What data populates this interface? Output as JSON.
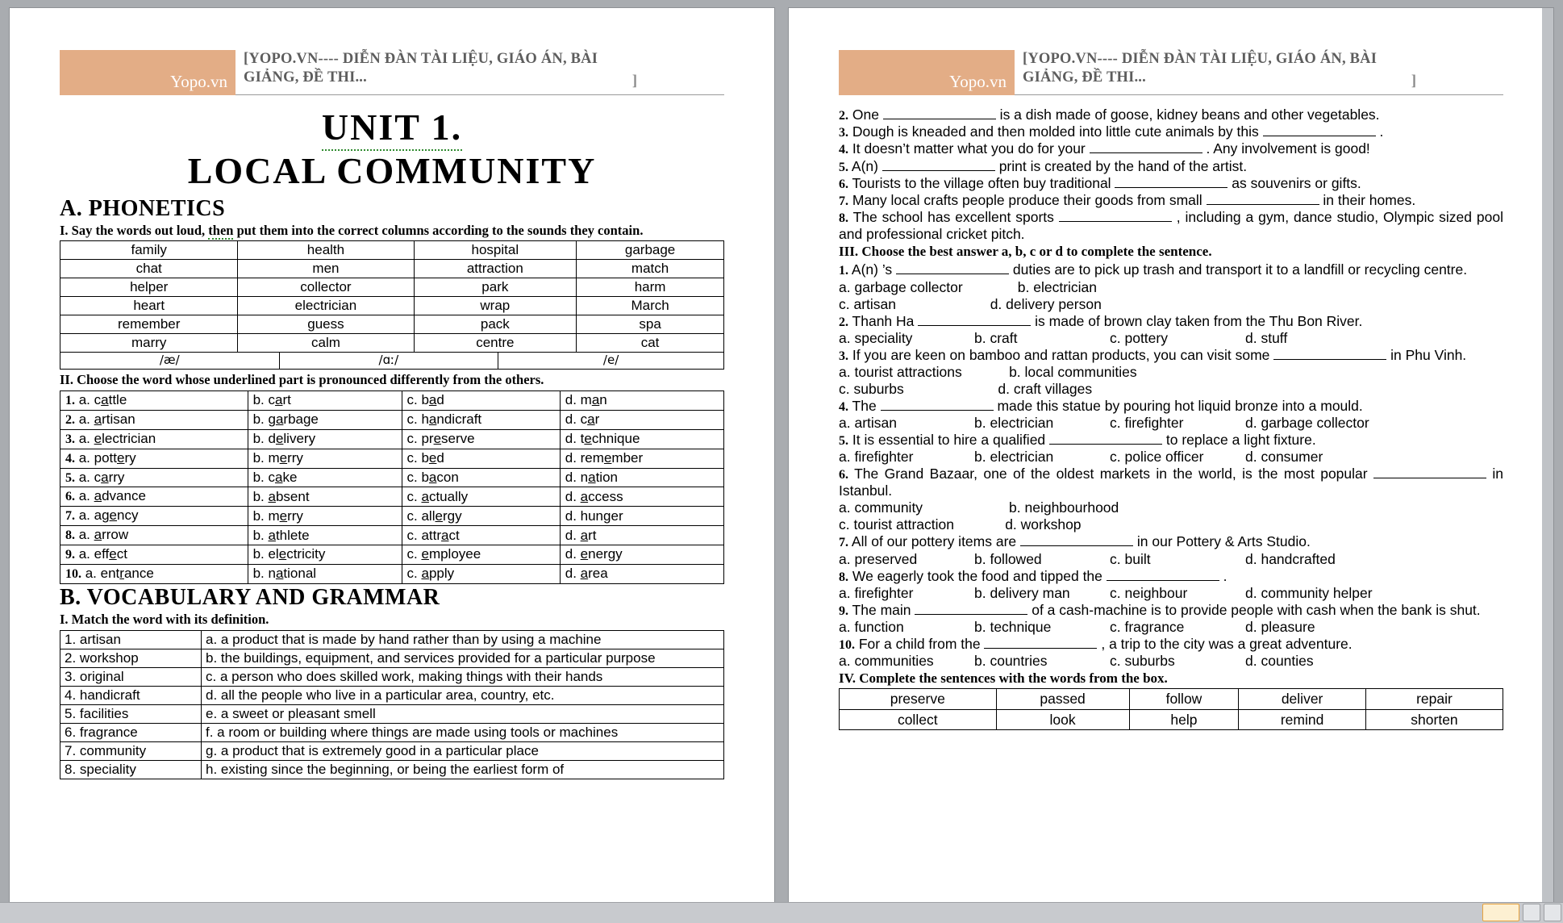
{
  "header": {
    "brand": "Yopo.vn",
    "line1": "[YOPO.VN---- DIỄN ĐÀN TÀI LIỆU, GIÁO ÁN, BÀI",
    "line2": "GIẢNG, ĐỀ THI...",
    "bracket_end": "]",
    "brand_color": "#e3ad86"
  },
  "page1": {
    "unit_title": "UNIT 1.",
    "unit_subtitle": "LOCAL COMMUNITY",
    "section_a": "A. PHONETICS",
    "exercise_i": "I. Say the words out loud, then put them into the correct columns according to the sounds they contain.",
    "exercise_i_squiggle_word": "then",
    "word_table": [
      [
        "family",
        "health",
        "hospital",
        "garbage"
      ],
      [
        "chat",
        "men",
        "attraction",
        "match"
      ],
      [
        "helper",
        "collector",
        "park",
        "harm"
      ],
      [
        "heart",
        "electrician",
        "wrap",
        "March"
      ],
      [
        "remember",
        "guess",
        "pack",
        "spa"
      ],
      [
        "marry",
        "calm",
        "centre",
        "cat"
      ]
    ],
    "phonetic_row": [
      "/æ/",
      "/ɑː/",
      "/e/"
    ],
    "exercise_ii": "II. Choose the word whose underlined part is pronounced differently from the others.",
    "choices": [
      {
        "n": "1.",
        "a": [
          "c",
          "a",
          "ttle"
        ],
        "b": [
          "c",
          "a",
          "rt"
        ],
        "c": [
          "b",
          "a",
          "d"
        ],
        "d": [
          "m",
          "a",
          "n"
        ]
      },
      {
        "n": "2.",
        "a": [
          "",
          "a",
          "rtisan"
        ],
        "b": [
          "g",
          "a",
          "rbage"
        ],
        "c": [
          "h",
          "a",
          "ndicraft"
        ],
        "d": [
          "c",
          "a",
          "r"
        ]
      },
      {
        "n": "3.",
        "a": [
          "",
          "e",
          "lectrician"
        ],
        "b": [
          "d",
          "e",
          "livery"
        ],
        "c": [
          "pr",
          "e",
          "serve"
        ],
        "d": [
          "t",
          "e",
          "chnique"
        ]
      },
      {
        "n": "4.",
        "a": [
          "pott",
          "e",
          "ry"
        ],
        "b": [
          "m",
          "e",
          "rry"
        ],
        "c": [
          "b",
          "e",
          "d"
        ],
        "d": [
          "rem",
          "e",
          "mber"
        ]
      },
      {
        "n": "5.",
        "a": [
          "c",
          "a",
          "rry"
        ],
        "b": [
          "c",
          "a",
          "ke"
        ],
        "c": [
          "b",
          "a",
          "con"
        ],
        "d": [
          "n",
          "a",
          "tion"
        ]
      },
      {
        "n": "6.",
        "a": [
          "",
          "a",
          "dvance"
        ],
        "b": [
          "",
          "a",
          "bsent"
        ],
        "c": [
          "",
          "a",
          "ctually"
        ],
        "d": [
          "",
          "a",
          "ccess"
        ]
      },
      {
        "n": "7.",
        "a": [
          "ag",
          "e",
          "ncy"
        ],
        "b": [
          "m",
          "e",
          "rry"
        ],
        "c": [
          "all",
          "e",
          "rgy"
        ],
        "d": [
          "hun",
          "g",
          "er"
        ]
      },
      {
        "n": "8.",
        "a": [
          "",
          "a",
          "rrow"
        ],
        "b": [
          "",
          "a",
          "thlete"
        ],
        "c": [
          "attr",
          "a",
          "ct"
        ],
        "d": [
          "",
          "a",
          "rt"
        ]
      },
      {
        "n": "9.",
        "a": [
          "eff",
          "e",
          "ct"
        ],
        "b": [
          "el",
          "e",
          "ctricity"
        ],
        "c": [
          "",
          "e",
          "mployee"
        ],
        "d": [
          "",
          "e",
          "nergy"
        ]
      },
      {
        "n": "10.",
        "a": [
          "ent",
          "r",
          "ance"
        ],
        "b": [
          "n",
          "a",
          "tional"
        ],
        "c": [
          "",
          "a",
          "pply"
        ],
        "d": [
          "",
          "a",
          "rea"
        ]
      }
    ],
    "section_b": "B. VOCABULARY AND GRAMMAR",
    "match_instruction": "I. Match the word with its definition.",
    "match_rows": [
      {
        "term": "1. artisan",
        "def": "a. a product that is made by hand rather than by using a machine"
      },
      {
        "term": "2. workshop",
        "def": "b. the buildings, equipment, and services provided for a particular purpose"
      },
      {
        "term": "3. original",
        "def": "c. a person who does skilled work, making things with their hands"
      },
      {
        "term": "4. handicraft",
        "def": "d. all the people who live in a particular area, country, etc."
      },
      {
        "term": "5. facilities",
        "def": "e. a sweet or pleasant smell"
      },
      {
        "term": "6. fragrance",
        "def": "f. a room or building where things are made using tools or machines"
      },
      {
        "term": "7. community",
        "def": "g. a product that is extremely good in a particular place"
      },
      {
        "term": "8. speciality",
        "def": "h. existing since the beginning, or being the earliest form of"
      }
    ]
  },
  "page2": {
    "fill_items": [
      {
        "n": "2.",
        "pre": "One",
        "post": "is a dish made of goose, kidney beans and other vegetables."
      },
      {
        "n": "3.",
        "pre": "Dough is kneaded and then molded into little cute animals by this",
        "post": "."
      },
      {
        "n": "4.",
        "pre": "It doesn’t matter what you do for your",
        "post": ". Any involvement is good!"
      },
      {
        "n": "5.",
        "pre": "A(n)",
        "post": "print is created by the hand of the artist."
      },
      {
        "n": "6.",
        "pre": "Tourists to the village often buy traditional",
        "post": "as souvenirs or gifts."
      },
      {
        "n": "7.",
        "pre": "Many local crafts people produce their goods from small",
        "post": "in their homes."
      },
      {
        "n": "8.",
        "pre": "The school has excellent sports",
        "post": ", including a gym, dance studio, Olympic sized pool and professional cricket pitch."
      }
    ],
    "instruction_iii": "III. Choose the best answer a, b, c or d to complete the sentence.",
    "mc_questions": [
      {
        "n": "1.",
        "pre": "A(n) ’s",
        "post": "duties are to pick up trash and transport it to a landfill or recycling centre.",
        "opts": [
          "a. garbage collector",
          "b. electrician",
          "c. artisan",
          "d. delivery person"
        ],
        "layout": "2x2"
      },
      {
        "n": "2.",
        "pre": "Thanh Ha",
        "post": "is made of brown clay taken from the Thu Bon River.",
        "opts": [
          "a. speciality",
          "b. craft",
          "c. pottery",
          "d. stuff"
        ],
        "layout": "1x4"
      },
      {
        "n": "3.",
        "pre": "If you are keen on bamboo and rattan products, you can visit some",
        "post": "in Phu Vinh.",
        "opts": [
          "a. tourist attractions",
          "b. local communities",
          "c. suburbs",
          "d. craft villages"
        ],
        "layout": "2x2"
      },
      {
        "n": "4.",
        "pre": "The",
        "post": "made this statue by pouring hot liquid bronze into a mould.",
        "opts": [
          "a.   artisan",
          "b.   electrician",
          "c.   firefighter",
          "d.   garbage collector"
        ],
        "layout": "1x4wrap"
      },
      {
        "n": "5.",
        "pre": "It is essential to hire a qualified",
        "post": "to replace a light fixture.",
        "opts": [
          "a. firefighter",
          "b. electrician",
          "c. police officer",
          "d. consumer"
        ],
        "layout": "1x4"
      },
      {
        "n": "6.",
        "pre": "The Grand Bazaar, one of the oldest markets in the world, is the most popular",
        "post": "in Istanbul.",
        "opts": [
          "a. community",
          "b. neighbourhood",
          "c. tourist attraction",
          "d. workshop"
        ],
        "layout": "2x2"
      },
      {
        "n": "7.",
        "pre": "All of our pottery items are",
        "post": "in our Pottery & Arts Studio.",
        "opts": [
          "a. preserved",
          "b. followed",
          "c. built",
          "d. handcrafted"
        ],
        "layout": "1x4"
      },
      {
        "n": "8.",
        "pre": "We eagerly took the food and tipped the",
        "post": ".",
        "opts": [
          "a.  firefighter",
          "b.  delivery man",
          "c.  neighbour",
          "d.  community helper"
        ],
        "layout": "1x4wrap"
      },
      {
        "n": "9.",
        "pre": "The main",
        "post": "of a cash-machine is to provide people with cash when the bank is shut.",
        "opts": [
          "a. function",
          "b. technique",
          "c. fragrance",
          "d. pleasure"
        ],
        "layout": "1x4"
      },
      {
        "n": "10.",
        "pre": "For a child from the",
        "post": ", a trip to the city was a great adventure.",
        "opts": [
          "a. communities",
          "b. countries",
          "c. suburbs",
          "d. counties"
        ],
        "layout": "1x4"
      }
    ],
    "instruction_iv": "IV. Complete the sentences with the words from the box.",
    "word_box": [
      [
        "preserve",
        "passed",
        "follow",
        "deliver",
        "repair"
      ],
      [
        "collect",
        "look",
        "help",
        "remind",
        "shorten"
      ]
    ]
  }
}
